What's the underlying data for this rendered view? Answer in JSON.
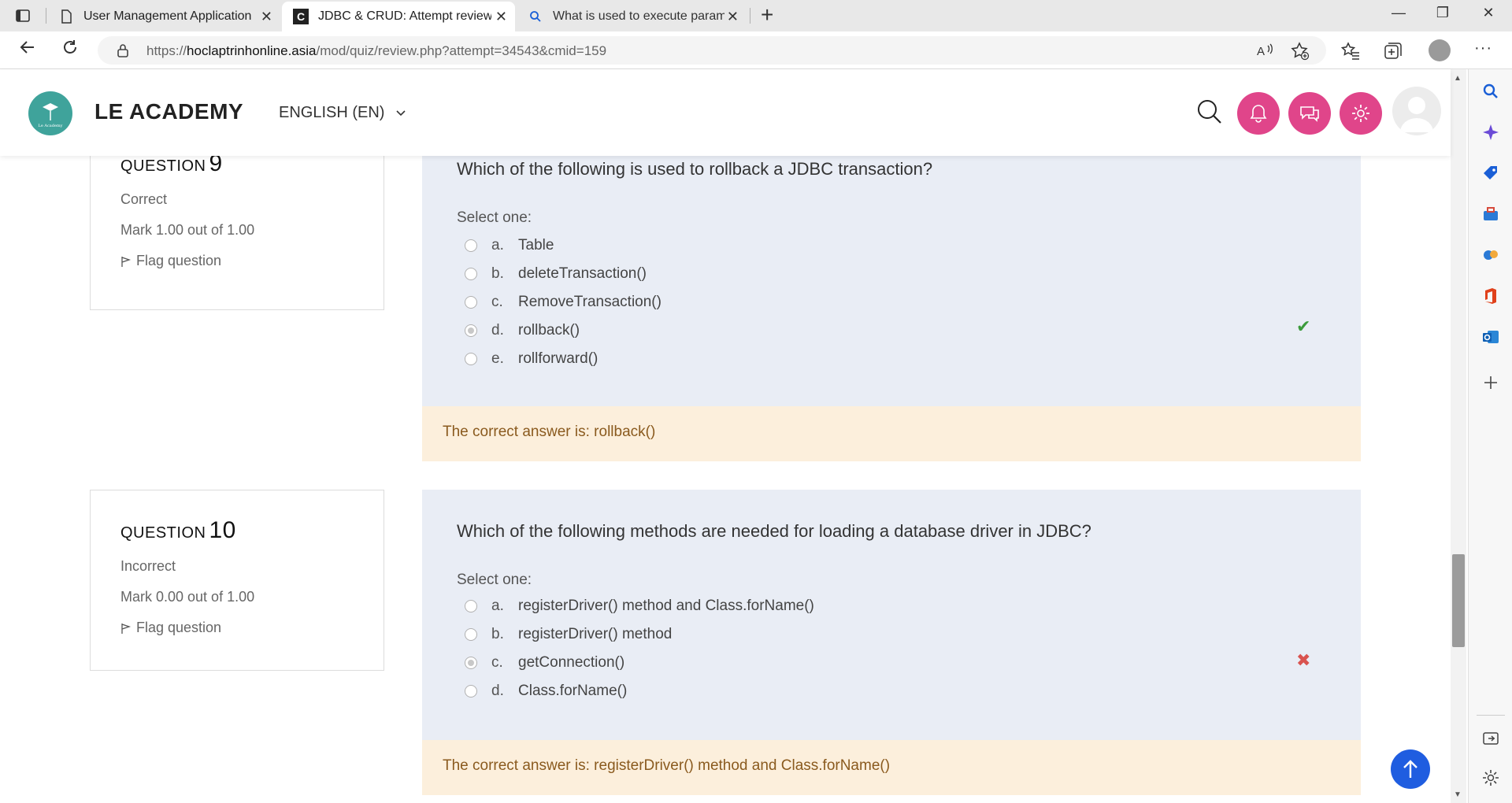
{
  "browser": {
    "tabs": [
      {
        "title": "User Management Application",
        "icon": "page-icon"
      },
      {
        "title": "JDBC & CRUD: Attempt review",
        "icon": "site-c-icon"
      },
      {
        "title": "What is used to execute paramet",
        "icon": "search-icon"
      }
    ],
    "close_glyph": "✕",
    "new_tab_glyph": "+",
    "url": {
      "scheme": "https://",
      "host": "hoclaptrinhonline.asia",
      "path": "/mod/quiz/review.php?attempt=34543&cmid=159"
    },
    "window_controls": {
      "minimize": "—",
      "restore": "❐",
      "close": "✕"
    }
  },
  "site": {
    "brand": "LE ACADEMY",
    "language": "ENGLISH (EN)",
    "logo_text": "Le Academy",
    "accent_color": "#e0458a"
  },
  "questions": [
    {
      "label": "QUESTION",
      "number": "9",
      "state": "Correct",
      "mark": "Mark 1.00 out of 1.00",
      "flag": "Flag question",
      "text": "Which of the following is used to rollback a JDBC transaction?",
      "select_label": "Select one:",
      "options": [
        {
          "letter": "a.",
          "text": "Table"
        },
        {
          "letter": "b.",
          "text": "deleteTransaction()"
        },
        {
          "letter": "c.",
          "text": "RemoveTransaction()"
        },
        {
          "letter": "d.",
          "text": "rollback()"
        },
        {
          "letter": "e.",
          "text": "rollforward()"
        }
      ],
      "selected_index": 3,
      "result_glyph": "✔",
      "feedback": "The correct answer is: rollback()"
    },
    {
      "label": "QUESTION",
      "number": "10",
      "state": "Incorrect",
      "mark": "Mark 0.00 out of 1.00",
      "flag": "Flag question",
      "text": "Which of the following methods are needed for loading a database driver in JDBC?",
      "select_label": "Select one:",
      "options": [
        {
          "letter": "a.",
          "text": "registerDriver() method and Class.forName()"
        },
        {
          "letter": "b.",
          "text": "registerDriver() method"
        },
        {
          "letter": "c.",
          "text": "getConnection()"
        },
        {
          "letter": "d.",
          "text": "Class.forName()"
        }
      ],
      "selected_index": 2,
      "result_glyph": "✖",
      "feedback": "The correct answer is: registerDriver() method and Class.forName()"
    }
  ]
}
